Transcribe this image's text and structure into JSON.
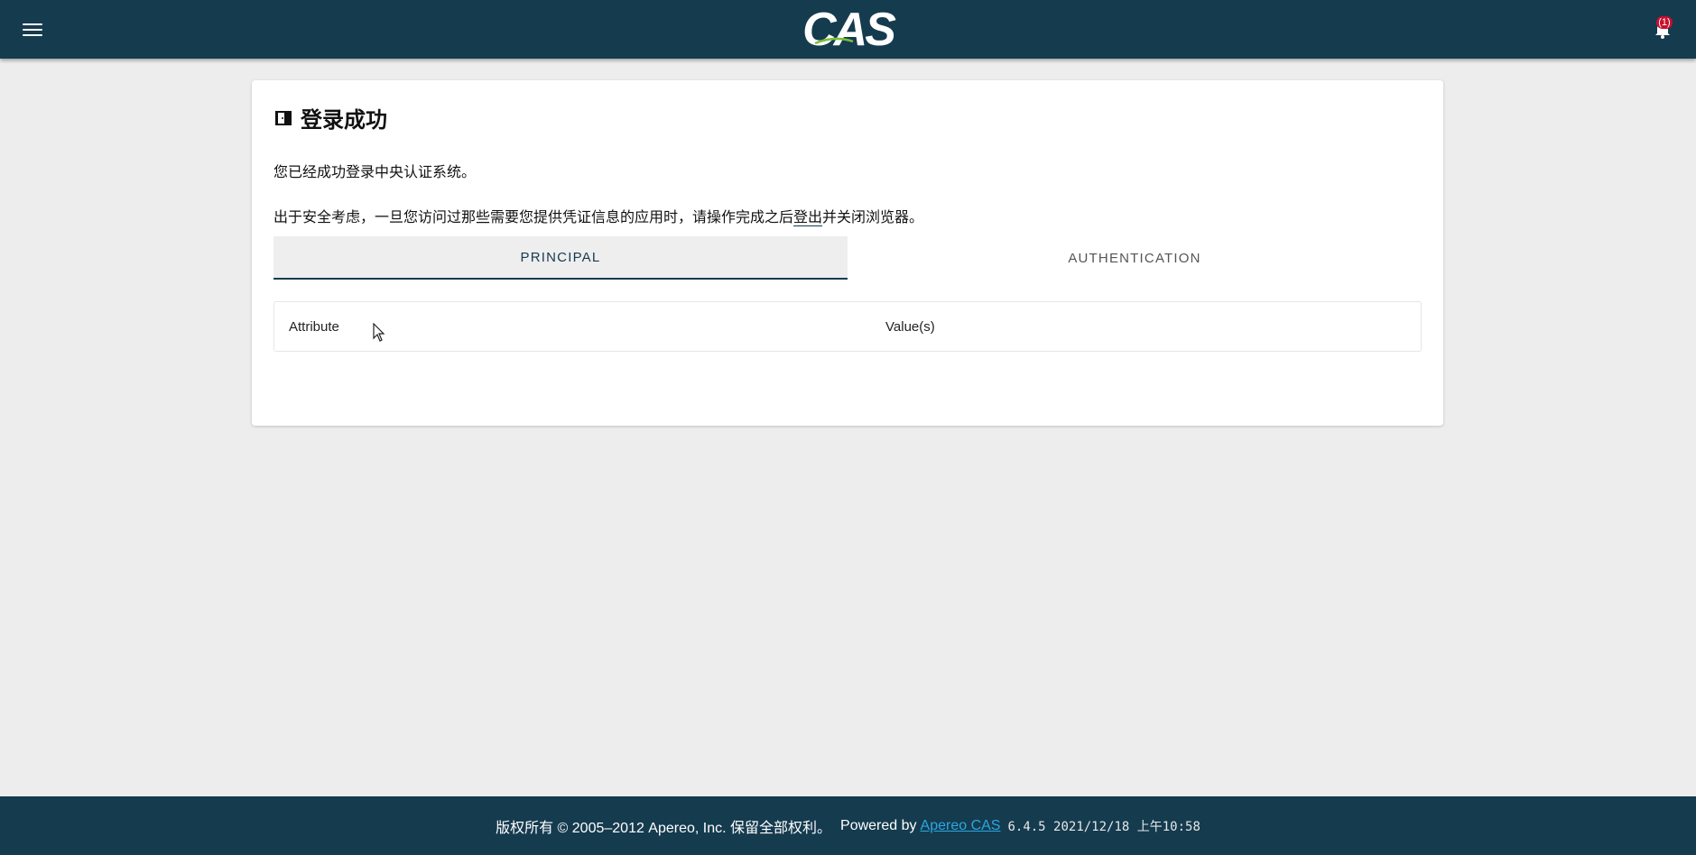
{
  "header": {
    "logo_text": "CAS",
    "notification_count": "(1)",
    "accent_color": "#153b4f"
  },
  "card": {
    "title": "登录成功",
    "message": "您已经成功登录中央认证系统。",
    "security_before": "出于安全考虑，一旦您访问过那些需要您提供凭证信息的应用时，请操作完成之后",
    "logout_link": "登出",
    "security_after": "并关闭浏览器。"
  },
  "tabs": [
    {
      "label": "PRINCIPAL",
      "active": true
    },
    {
      "label": "AUTHENTICATION",
      "active": false
    }
  ],
  "table": {
    "columns": [
      "Attribute",
      "Value(s)"
    ]
  },
  "footer": {
    "copyright": "版权所有 © 2005–2012 Apereo, Inc. 保留全部权利。",
    "powered_by": "Powered by",
    "link_text": "Apereo CAS",
    "version": "6.4.5 2021/12/18 上午10:58",
    "link_color": "#29a8e0"
  },
  "icons": {
    "menu": "hamburger-menu-icon",
    "notification": "bell-icon",
    "title": "door-icon"
  }
}
